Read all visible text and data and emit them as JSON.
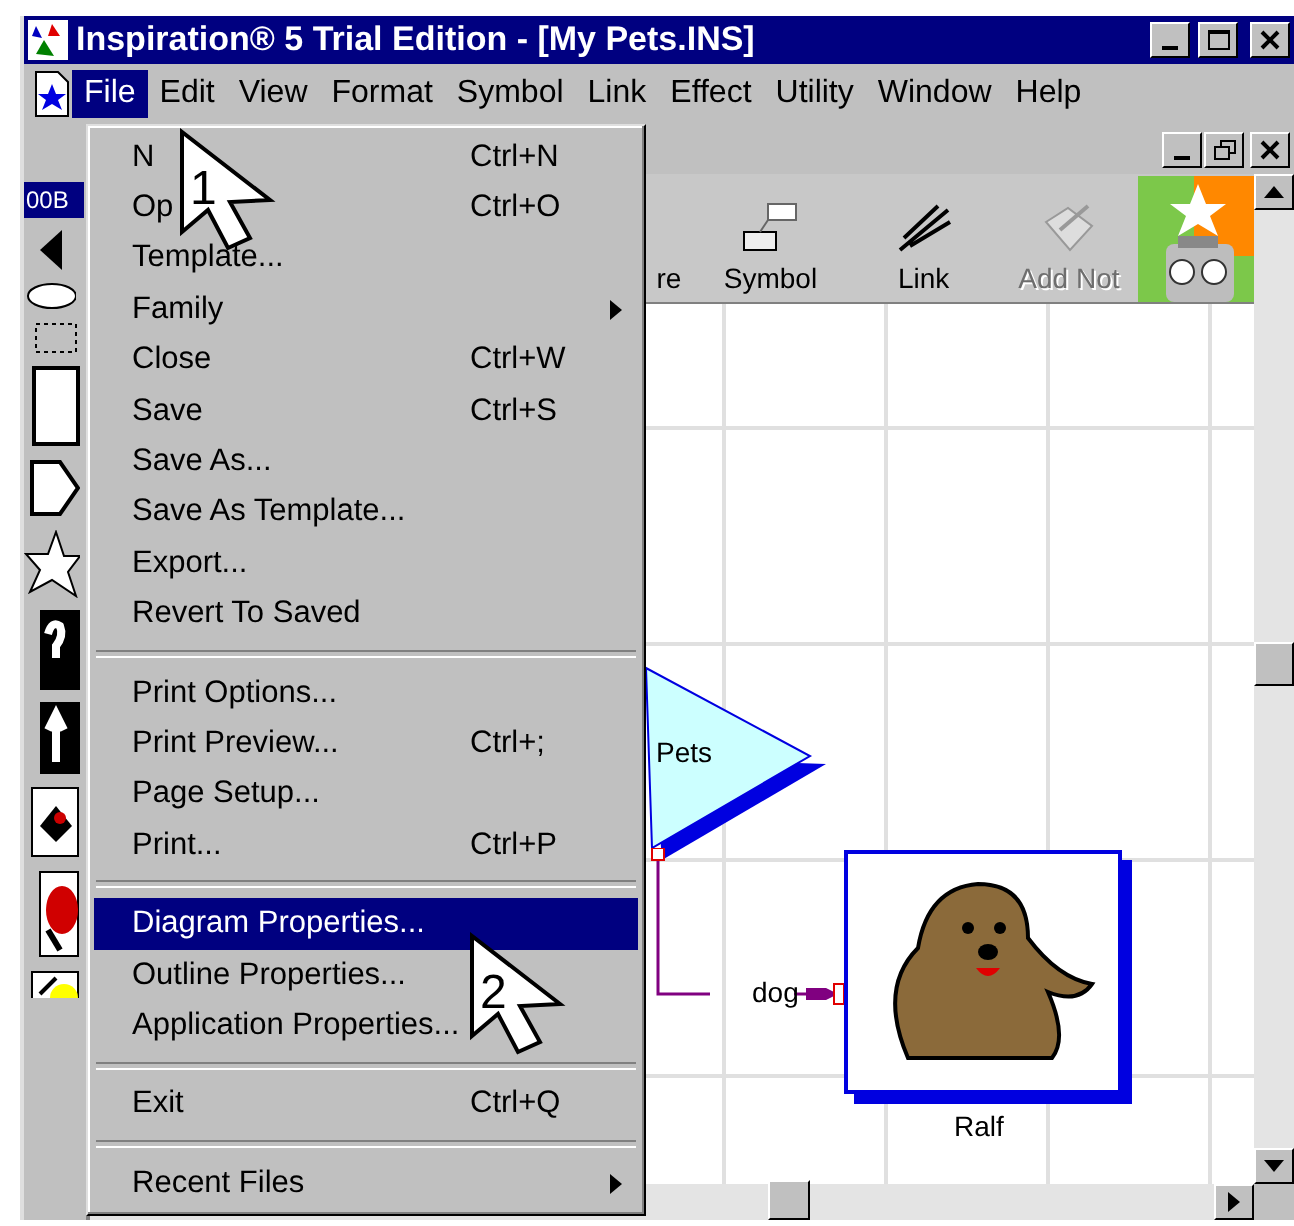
{
  "window": {
    "title": "Inspiration® 5 Trial Edition - [My Pets.INS]"
  },
  "menu_bar": [
    {
      "label": "File",
      "selected": true
    },
    {
      "label": "Edit",
      "selected": false
    },
    {
      "label": "View",
      "selected": false
    },
    {
      "label": "Format",
      "selected": false
    },
    {
      "label": "Symbol",
      "selected": false
    },
    {
      "label": "Link",
      "selected": false
    },
    {
      "label": "Effect",
      "selected": false
    },
    {
      "label": "Utility",
      "selected": false
    },
    {
      "label": "Window",
      "selected": false
    },
    {
      "label": "Help",
      "selected": false
    }
  ],
  "file_menu": [
    {
      "kind": "item",
      "label": "N",
      "shortcut": "Ctrl+N",
      "submenu": false,
      "selected": false
    },
    {
      "kind": "item",
      "label": "Op",
      "shortcut": "Ctrl+O",
      "submenu": false,
      "selected": false
    },
    {
      "kind": "item",
      "label": "Template...",
      "submenu": false,
      "selected": false
    },
    {
      "kind": "item",
      "label": "Family",
      "submenu": true,
      "selected": false
    },
    {
      "kind": "item",
      "label": "Close",
      "shortcut": "Ctrl+W",
      "submenu": false,
      "selected": false
    },
    {
      "kind": "item",
      "label": "Save",
      "shortcut": "Ctrl+S",
      "submenu": false,
      "selected": false
    },
    {
      "kind": "item",
      "label": "Save As...",
      "submenu": false,
      "selected": false
    },
    {
      "kind": "item",
      "label": "Save As Template...",
      "submenu": false,
      "selected": false
    },
    {
      "kind": "item",
      "label": "Export...",
      "submenu": false,
      "selected": false
    },
    {
      "kind": "item",
      "label": "Revert To Saved",
      "submenu": false,
      "selected": false
    },
    {
      "kind": "separator"
    },
    {
      "kind": "item",
      "label": "Print Options...",
      "submenu": false,
      "selected": false
    },
    {
      "kind": "item",
      "label": "Print Preview...",
      "shortcut": "Ctrl+;",
      "submenu": false,
      "selected": false
    },
    {
      "kind": "item",
      "label": "Page Setup...",
      "submenu": false,
      "selected": false
    },
    {
      "kind": "item",
      "label": "Print...",
      "shortcut": "Ctrl+P",
      "submenu": false,
      "selected": false
    },
    {
      "kind": "separator"
    },
    {
      "kind": "item",
      "label": "Diagram Properties...",
      "submenu": false,
      "selected": true
    },
    {
      "kind": "item",
      "label": "Outline Properties...",
      "submenu": false,
      "selected": false
    },
    {
      "kind": "item",
      "label": "Application Properties...",
      "submenu": false,
      "selected": false
    },
    {
      "kind": "separator"
    },
    {
      "kind": "item",
      "label": "Exit",
      "shortcut": "Ctrl+Q",
      "submenu": false,
      "selected": false
    },
    {
      "kind": "separator"
    },
    {
      "kind": "item",
      "label": "Recent Files",
      "submenu": true,
      "selected": false
    }
  ],
  "palette": {
    "label": "00B"
  },
  "toolbar": [
    {
      "kind": "cut",
      "label": "re",
      "disabled": false
    },
    {
      "kind": "symbol",
      "label": "Symbol",
      "disabled": false
    },
    {
      "kind": "link",
      "label": "Link",
      "disabled": false
    },
    {
      "kind": "note",
      "label": "Add Not",
      "disabled": true
    }
  ],
  "diagram": {
    "main_idea": "Pets",
    "link_label": "dog",
    "node_label": "Ralf"
  },
  "callouts": [
    "1",
    "2"
  ]
}
